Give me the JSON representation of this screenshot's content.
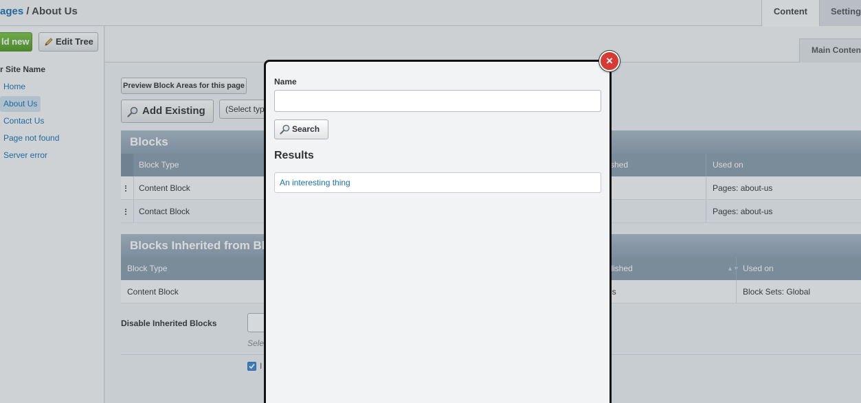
{
  "header": {
    "breadcrumb_link": "ages",
    "breadcrumb_sep": " / ",
    "breadcrumb_current": "About Us",
    "tabs": [
      {
        "label": "Content"
      },
      {
        "label": "Settings"
      }
    ]
  },
  "sidebar": {
    "add_new_label": "ld new",
    "edit_tree_label": "Edit Tree",
    "site_name": "r Site Name",
    "items": [
      {
        "label": "Home"
      },
      {
        "label": "About Us"
      },
      {
        "label": "Contact Us"
      },
      {
        "label": "Page not found"
      },
      {
        "label": "Server error"
      }
    ]
  },
  "main": {
    "subtab": "Main Content",
    "preview_button": "Preview Block Areas for this page",
    "add_existing_button": "Add Existing",
    "select_type": "(Select typ",
    "blocks": {
      "title": "Blocks",
      "columns": [
        "Block Type",
        "blished",
        "Used on"
      ],
      "rows": [
        {
          "type": "Content Block",
          "used_on": "Pages: about-us"
        },
        {
          "type": "Contact Block",
          "used_on": "Pages: about-us"
        }
      ]
    },
    "inherited": {
      "title": "Blocks Inherited from Bl",
      "columns": [
        "Block Type",
        "ublished",
        "Used on"
      ],
      "rows": [
        {
          "type": "Content Block",
          "published": "es",
          "used_on": "Block Sets: Global"
        }
      ]
    },
    "disable_label": "Disable Inherited Blocks",
    "select_hint": "Sele",
    "checkbox_label": "I"
  },
  "modal": {
    "close_glyph": "×",
    "name_label": "Name",
    "name_value": "",
    "search_button": "Search",
    "results_title": "Results",
    "results": [
      {
        "label": "An interesting thing"
      }
    ]
  },
  "colors": {
    "link": "#1a6fb0",
    "add_button": "#5aa82a",
    "table_header": "#8a9bac",
    "close_button": "#d63a32"
  }
}
